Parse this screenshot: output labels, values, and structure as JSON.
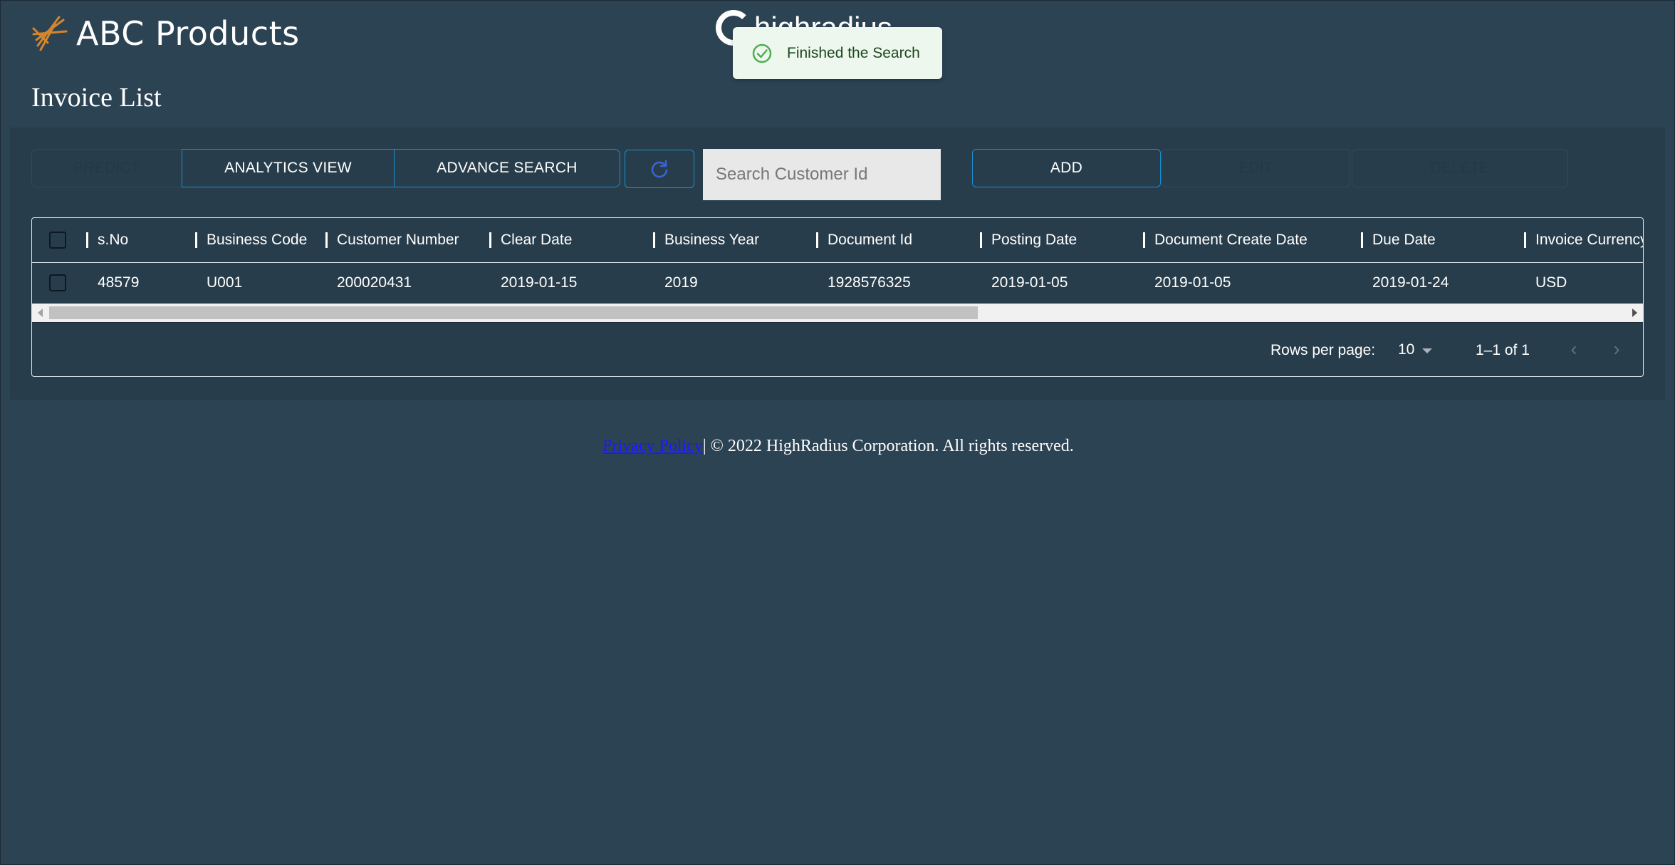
{
  "header": {
    "brand": "ABC Products",
    "partner_logo_text": "highradius",
    "logo_icon": "abc-logo-icon"
  },
  "toast": {
    "message": "Finished the Search",
    "icon": "check-circle-icon",
    "color": "#edf7ed"
  },
  "page": {
    "title": "Invoice List"
  },
  "toolbar": {
    "predict": "PREDICT",
    "analytics_view": "ANALYTICS VIEW",
    "advance_search": "ADVANCE SEARCH",
    "refresh_icon": "refresh-icon",
    "search_placeholder": "Search Customer Id",
    "add": "ADD",
    "edit": "EDIT",
    "delete": "DELETE",
    "accent": "#1d8fd0"
  },
  "grid": {
    "columns": [
      "s.No",
      "Business Code",
      "Customer Number",
      "Clear Date",
      "Business Year",
      "Document Id",
      "Posting Date",
      "Document Create Date",
      "Due Date",
      "Invoice Currency"
    ],
    "rows": [
      [
        "48579",
        "U001",
        "200020431",
        "2019-01-15",
        "2019",
        "1928576325",
        "2019-01-05",
        "2019-01-05",
        "2019-01-24",
        "USD"
      ]
    ],
    "rows_per_page_label": "Rows per page:",
    "rows_per_page": "10",
    "range": "1–1 of 1",
    "prev": "‹",
    "next": "›"
  },
  "footer": {
    "link": "Privacy Policy",
    "text": "| © 2022 HighRadius Corporation. All rights reserved."
  }
}
